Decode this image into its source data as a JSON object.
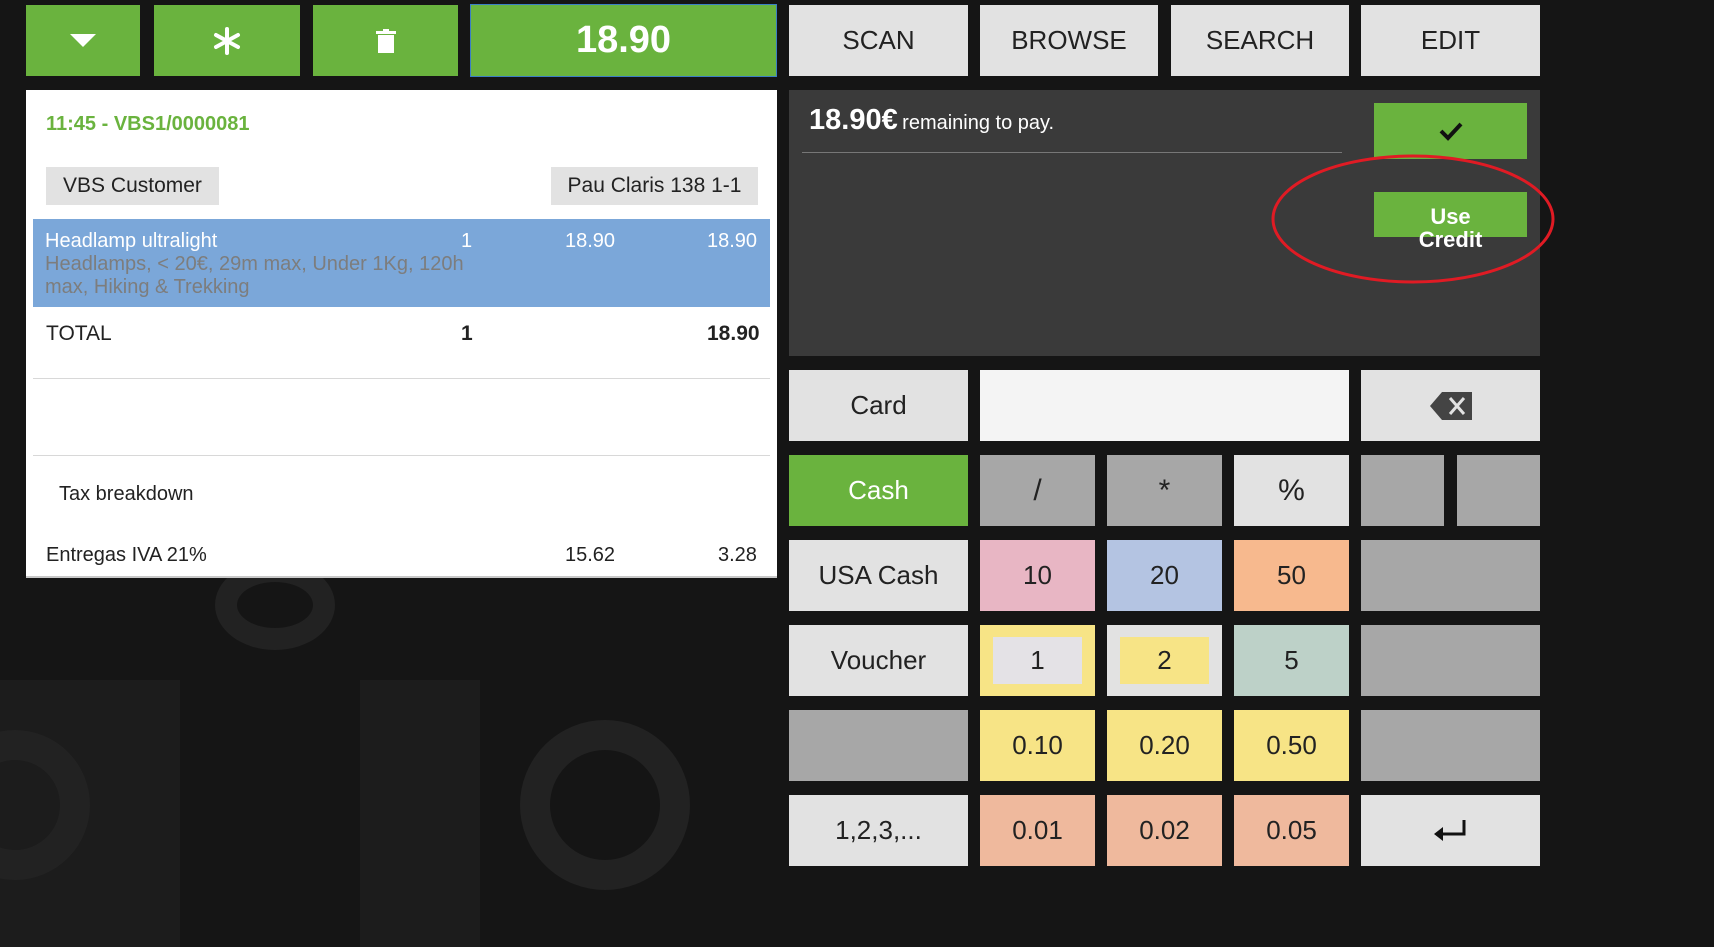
{
  "topbar": {
    "total_display": "18.90",
    "menu_buttons": [
      "SCAN",
      "BROWSE",
      "SEARCH",
      "EDIT"
    ]
  },
  "receipt": {
    "header": "11:45 - VBS1/0000081",
    "customer": "VBS Customer",
    "address": "Pau Claris 138 1-1",
    "line": {
      "name": "Headlamp ultralight",
      "qty": "1",
      "price": "18.90",
      "total": "18.90",
      "desc_line1": "Headlamps, < 20€, 29m max, Under 1Kg, 120h",
      "desc_line2": "max, Hiking & Trekking"
    },
    "total_label": "TOTAL",
    "total_qty": "1",
    "total_amount": "18.90",
    "tax_title": "Tax breakdown",
    "tax_label": "Entregas IVA 21%",
    "tax_base": "15.62",
    "tax_amount": "3.28"
  },
  "payment": {
    "remaining_amount": "18.90€",
    "remaining_text": "remaining to pay.",
    "use_credit_line1": "Use",
    "use_credit_line2": "Credit",
    "annotation_color": "#e01b24"
  },
  "keypad": {
    "methods": [
      "Card",
      "Cash",
      "USA Cash",
      "Voucher",
      "",
      "1,2,3,..."
    ],
    "ops": [
      "/",
      "*",
      "%"
    ],
    "row_notes": [
      "10",
      "20",
      "50"
    ],
    "row_coins_big": [
      "1",
      "2",
      "5"
    ],
    "row_cents_high": [
      "0.10",
      "0.20",
      "0.50"
    ],
    "row_cents_low": [
      "0.01",
      "0.02",
      "0.05"
    ],
    "input_value": ""
  },
  "colors": {
    "green": "#6ab33e",
    "selected_row": "#7ba7d9"
  }
}
